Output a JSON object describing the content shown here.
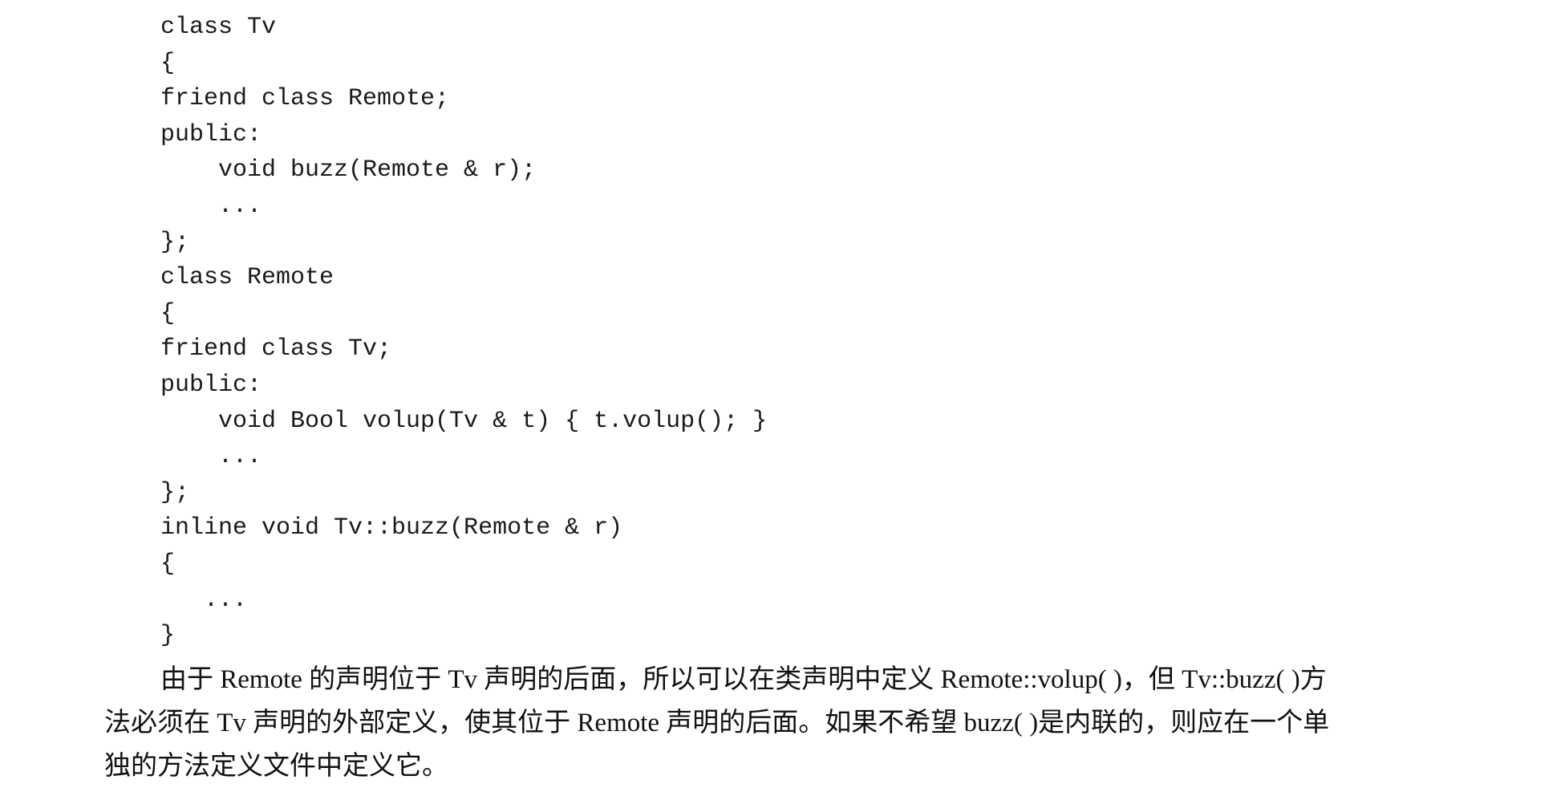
{
  "code_block": {
    "lines": [
      "class Tv",
      "{",
      "friend class Remote;",
      "public:",
      "    void buzz(Remote & r);",
      "    ...",
      "};",
      "class Remote",
      "{",
      "friend class Tv;",
      "public:",
      "    void Bool volup(Tv & t) { t.volup(); }",
      "    ...",
      "};",
      "inline void Tv::buzz(Remote & r)",
      "{",
      "   ...",
      "}"
    ]
  },
  "paragraph": {
    "lines": [
      "由于 Remote 的声明位于 Tv 声明的后面，所以可以在类声明中定义 Remote::volup( )，但 Tv::buzz( )方",
      "法必须在 Tv 声明的外部定义，使其位于 Remote 声明的后面。如果不希望 buzz( )是内联的，则应在一个单",
      "独的方法定义文件中定义它。"
    ]
  }
}
